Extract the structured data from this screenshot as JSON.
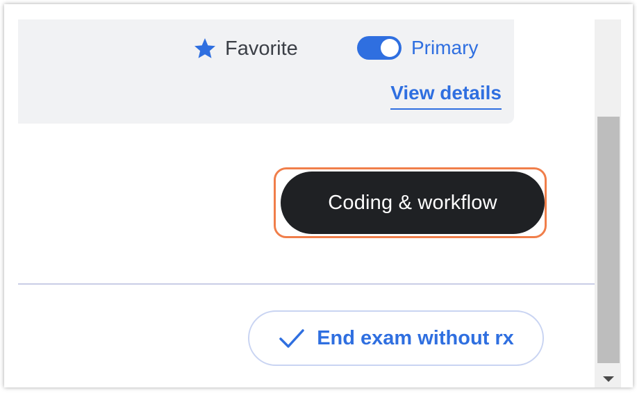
{
  "card": {
    "favorite_icon": "star-icon",
    "favorite_label": "Favorite",
    "primary_label": "Primary",
    "primary_toggle_on": true,
    "view_details_label": "View details"
  },
  "actions": {
    "coding_workflow_label": "Coding & workflow",
    "end_exam_icon": "checkmark-icon",
    "end_exam_label": "End exam without rx"
  },
  "colors": {
    "accent": "#2f6fe0",
    "dark_button": "#1f2124",
    "highlight_outline": "#f07e4a",
    "card_background": "#f1f2f4"
  }
}
